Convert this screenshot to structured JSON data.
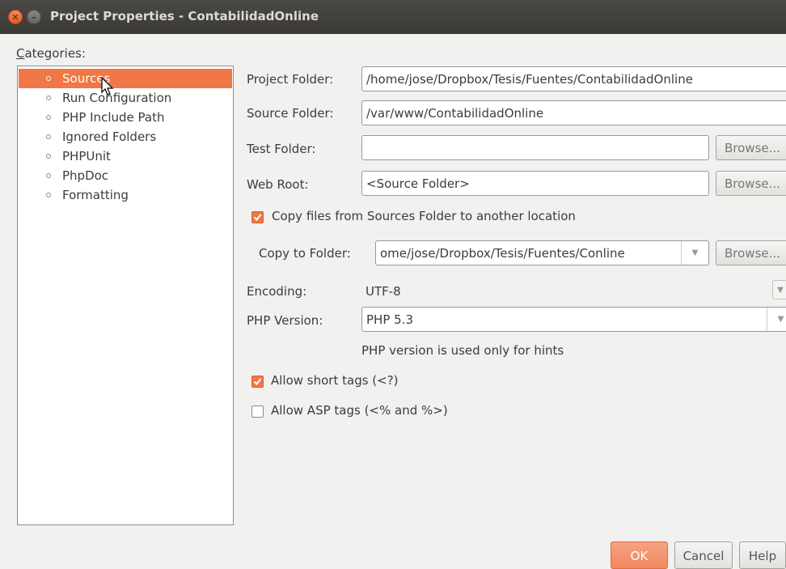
{
  "window": {
    "title": "Project Properties - ContabilidadOnline"
  },
  "categories": {
    "label": "Categories:",
    "items": [
      {
        "label": "Sources",
        "selected": true
      },
      {
        "label": "Run Configuration"
      },
      {
        "label": "PHP Include Path"
      },
      {
        "label": "Ignored Folders"
      },
      {
        "label": "PHPUnit"
      },
      {
        "label": "PhpDoc"
      },
      {
        "label": "Formatting"
      }
    ]
  },
  "form": {
    "project_folder": {
      "label": "Project Folder:",
      "value": "/home/jose/Dropbox/Tesis/Fuentes/ContabilidadOnline"
    },
    "source_folder": {
      "label": "Source Folder:",
      "value": "/var/www/ContabilidadOnline"
    },
    "test_folder": {
      "label": "Test Folder:",
      "value": "",
      "browse": "Browse..."
    },
    "web_root": {
      "label": "Web Root:",
      "value": "<Source Folder>",
      "browse": "Browse..."
    },
    "copy_files": {
      "label": "Copy files from Sources Folder to another location",
      "checked": true
    },
    "copy_to_folder": {
      "label": "Copy to Folder:",
      "value": "ome/jose/Dropbox/Tesis/Fuentes/Conline",
      "browse": "Browse..."
    },
    "encoding": {
      "label": "Encoding:",
      "value": "UTF-8"
    },
    "php_version": {
      "label": "PHP Version:",
      "value": "PHP 5.3",
      "hint": "PHP version is used only for hints"
    },
    "short_tags": {
      "label": "Allow short tags (<?)",
      "checked": true
    },
    "asp_tags": {
      "label": "Allow ASP tags (<% and %>)",
      "checked": false
    }
  },
  "buttons": {
    "ok": "OK",
    "cancel": "Cancel",
    "help": "Help"
  },
  "colors": {
    "accent": "#f07746",
    "titlebar": "#3c3b37"
  }
}
